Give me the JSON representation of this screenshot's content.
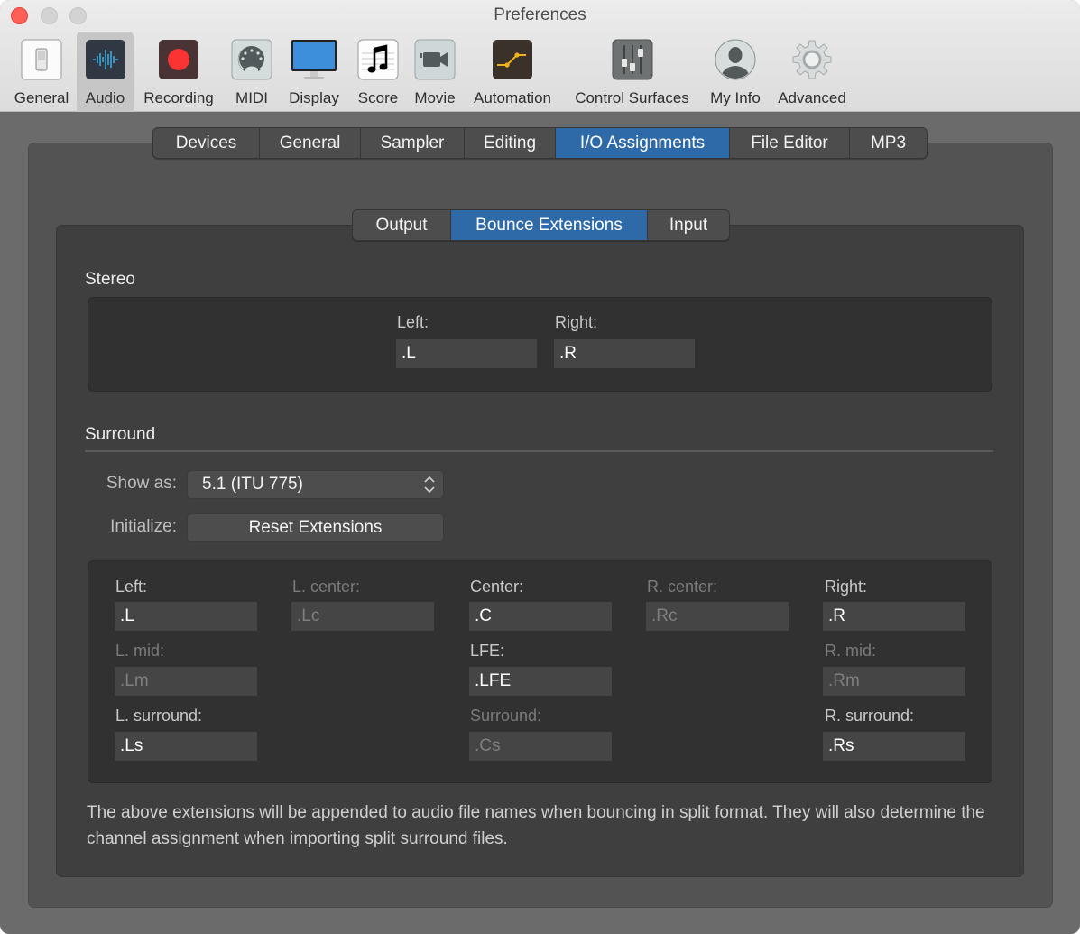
{
  "window": {
    "title": "Preferences"
  },
  "toolbar": {
    "items": [
      {
        "label": "General",
        "icon": "switch-icon",
        "selected": false
      },
      {
        "label": "Audio",
        "icon": "waveform-icon",
        "selected": true
      },
      {
        "label": "Recording",
        "icon": "record-icon",
        "selected": false
      },
      {
        "label": "MIDI",
        "icon": "midi-connector-icon",
        "selected": false
      },
      {
        "label": "Display",
        "icon": "monitor-icon",
        "selected": false
      },
      {
        "label": "Score",
        "icon": "music-note-icon",
        "selected": false
      },
      {
        "label": "Movie",
        "icon": "video-camera-icon",
        "selected": false
      },
      {
        "label": "Automation",
        "icon": "automation-curve-icon",
        "selected": false
      },
      {
        "label": "Control Surfaces",
        "icon": "faders-icon",
        "selected": false
      },
      {
        "label": "My Info",
        "icon": "user-silhouette-icon",
        "selected": false
      },
      {
        "label": "Advanced",
        "icon": "gear-icon",
        "selected": false
      }
    ]
  },
  "tabs": {
    "items": [
      "Devices",
      "General",
      "Sampler",
      "Editing",
      "I/O Assignments",
      "File Editor",
      "MP3"
    ],
    "active": "I/O Assignments"
  },
  "subtabs": {
    "items": [
      "Output",
      "Bounce Extensions",
      "Input"
    ],
    "active": "Bounce Extensions"
  },
  "stereo": {
    "title": "Stereo",
    "left": {
      "label": "Left:",
      "value": ".L"
    },
    "right": {
      "label": "Right:",
      "value": ".R"
    }
  },
  "surround": {
    "title": "Surround",
    "show_as_label": "Show as:",
    "show_as_value": "5.1 (ITU 775)",
    "initialize_label": "Initialize:",
    "reset_button": "Reset Extensions",
    "channels": {
      "left": {
        "label": "Left:",
        "value": ".L",
        "enabled": true
      },
      "l_center": {
        "label": "L. center:",
        "value": ".Lc",
        "enabled": false
      },
      "center": {
        "label": "Center:",
        "value": ".C",
        "enabled": true
      },
      "r_center": {
        "label": "R. center:",
        "value": ".Rc",
        "enabled": false
      },
      "right": {
        "label": "Right:",
        "value": ".R",
        "enabled": true
      },
      "l_mid": {
        "label": "L. mid:",
        "value": ".Lm",
        "enabled": false
      },
      "lfe": {
        "label": "LFE:",
        "value": ".LFE",
        "enabled": true
      },
      "r_mid": {
        "label": "R. mid:",
        "value": ".Rm",
        "enabled": false
      },
      "l_surround": {
        "label": "L. surround:",
        "value": ".Ls",
        "enabled": true
      },
      "surround": {
        "label": "Surround:",
        "value": ".Cs",
        "enabled": false
      },
      "r_surround": {
        "label": "R. surround:",
        "value": ".Rs",
        "enabled": true
      }
    }
  },
  "note": "The above extensions will be appended to audio file names when bouncing in split format. They will also determine the channel assignment when importing split surround files.",
  "colors": {
    "accent": "#2f6aa8",
    "close": "#fe5f57"
  }
}
